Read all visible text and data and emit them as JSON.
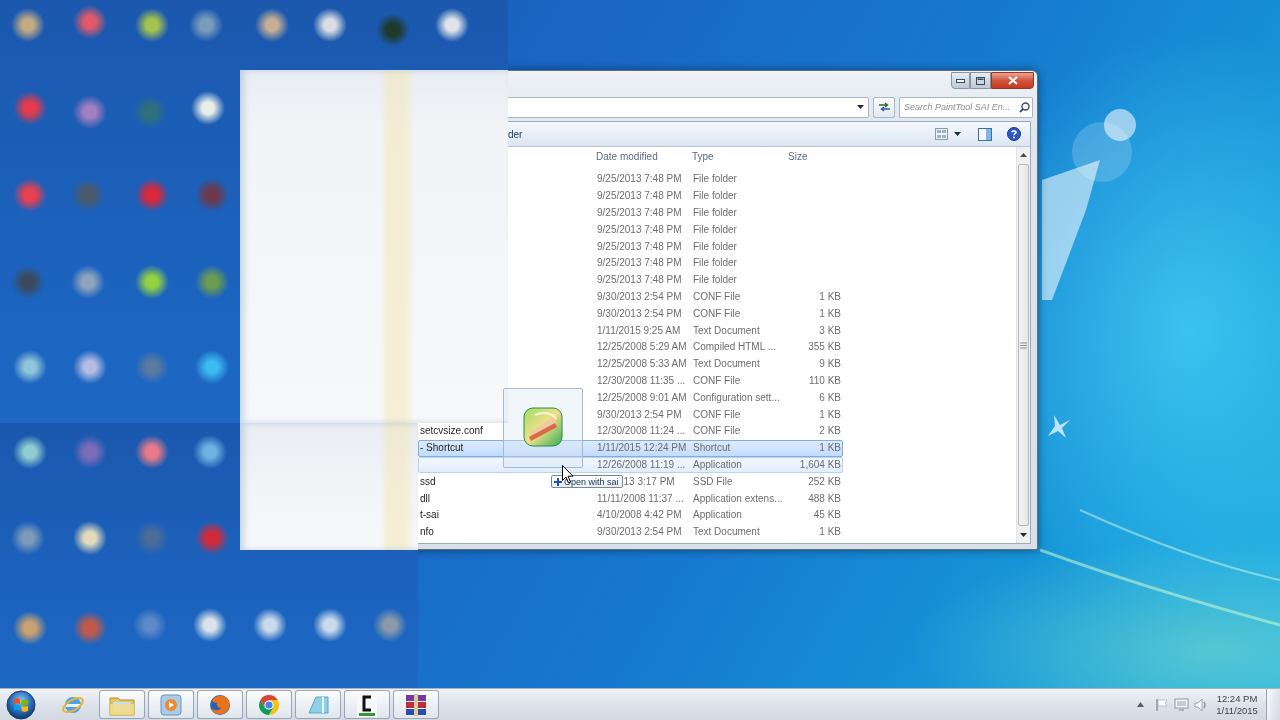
{
  "window": {
    "search": {
      "placeholder": "Search PaintTool SAI En..."
    },
    "toolbar": {
      "label": "der"
    },
    "columns": [
      "Date modified",
      "Type",
      "Size"
    ],
    "rows": [
      {
        "date": "9/25/2013 7:48 PM",
        "type": "File folder",
        "selected": false,
        "drop_target": false,
        "drag_tooltip": false
      },
      {
        "date": "9/25/2013 7:48 PM",
        "type": "File folder",
        "selected": false,
        "drop_target": false,
        "drag_tooltip": false
      },
      {
        "date": "9/25/2013 7:48 PM",
        "type": "File folder",
        "selected": false,
        "drop_target": false,
        "drag_tooltip": false
      },
      {
        "date": "9/25/2013 7:48 PM",
        "type": "File folder",
        "selected": false,
        "drop_target": false,
        "drag_tooltip": false
      },
      {
        "date": "9/25/2013 7:48 PM",
        "type": "File folder",
        "selected": false,
        "drop_target": false,
        "drag_tooltip": false
      },
      {
        "date": "9/25/2013 7:48 PM",
        "type": "File folder",
        "selected": false,
        "drop_target": false,
        "drag_tooltip": false
      },
      {
        "date": "9/25/2013 7:48 PM",
        "type": "File folder",
        "selected": false,
        "drop_target": false,
        "drag_tooltip": false
      },
      {
        "date": "9/30/2013 2:54 PM",
        "type": "CONF File",
        "size": "1 KB",
        "selected": false,
        "drop_target": false,
        "drag_tooltip": false
      },
      {
        "date": "9/30/2013 2:54 PM",
        "type": "CONF File",
        "size": "1 KB",
        "selected": false,
        "drop_target": false,
        "drag_tooltip": false
      },
      {
        "date": "1/11/2015 9:25 AM",
        "type": "Text Document",
        "size": "3 KB",
        "selected": false,
        "drop_target": false,
        "drag_tooltip": false
      },
      {
        "date": "12/25/2008 5:29 AM",
        "type": "Compiled HTML ...",
        "size": "355 KB",
        "selected": false,
        "drop_target": false,
        "drag_tooltip": false
      },
      {
        "date": "12/25/2008 5:33 AM",
        "type": "Text Document",
        "size": "9 KB",
        "selected": false,
        "drop_target": false,
        "drag_tooltip": false
      },
      {
        "date": "12/30/2008 11:35 ...",
        "type": "CONF File",
        "size": "110 KB",
        "selected": false,
        "drop_target": false,
        "drag_tooltip": false
      },
      {
        "date": "12/25/2008 9:01 AM",
        "type": "Configuration sett...",
        "size": "6 KB",
        "selected": false,
        "drop_target": false,
        "drag_tooltip": false
      },
      {
        "date": "9/30/2013 2:54 PM",
        "type": "CONF File",
        "size": "1 KB",
        "selected": false,
        "drop_target": false,
        "drag_tooltip": false
      },
      {
        "name": "setcvsize.conf",
        "date": "12/30/2008 11:24 ...",
        "type": "CONF File",
        "size": "2 KB",
        "selected": false,
        "drop_target": false,
        "drag_tooltip": false
      },
      {
        "name": "- Shortcut",
        "date": "1/11/2015 12:24 PM",
        "type": "Shortcut",
        "size": "1 KB",
        "selected": true,
        "drop_target": false,
        "drag_tooltip": false
      },
      {
        "date": "12/26/2008 11:19 ...",
        "type": "Application",
        "size": "1,604 KB",
        "selected": false,
        "drop_target": true,
        "drag_tooltip": false
      },
      {
        "name": "ssd",
        "date": "13 3:17 PM",
        "type": "SSD File",
        "size": "252 KB",
        "selected": false,
        "drop_target": false,
        "drag_tooltip": true
      },
      {
        "name": "dll",
        "date": "11/11/2008 11:37 ...",
        "type": "Application extens...",
        "size": "488 KB",
        "selected": false,
        "drop_target": false,
        "drag_tooltip": false
      },
      {
        "name": "t-sai",
        "date": "4/10/2008 4:42 PM",
        "type": "Application",
        "size": "45 KB",
        "selected": false,
        "drop_target": false,
        "drag_tooltip": false
      },
      {
        "name": "nfo",
        "date": "9/30/2013 2:54 PM",
        "type": "Text Document",
        "size": "1 KB",
        "selected": false,
        "drop_target": false,
        "drag_tooltip": false
      }
    ],
    "drag": {
      "tooltip": "Open with sai"
    }
  },
  "taskbar": {
    "apps": [
      {
        "kind": "ie",
        "running": false
      },
      {
        "kind": "explorer",
        "running": true
      },
      {
        "kind": "media",
        "running": true
      },
      {
        "kind": "firefox",
        "running": true
      },
      {
        "kind": "chrome",
        "running": true
      },
      {
        "kind": "tablet",
        "running": true
      },
      {
        "kind": "editor",
        "running": true
      },
      {
        "kind": "archive",
        "running": true
      }
    ],
    "clock": {
      "time": "12:24 PM",
      "date": "1/11/2015"
    }
  }
}
